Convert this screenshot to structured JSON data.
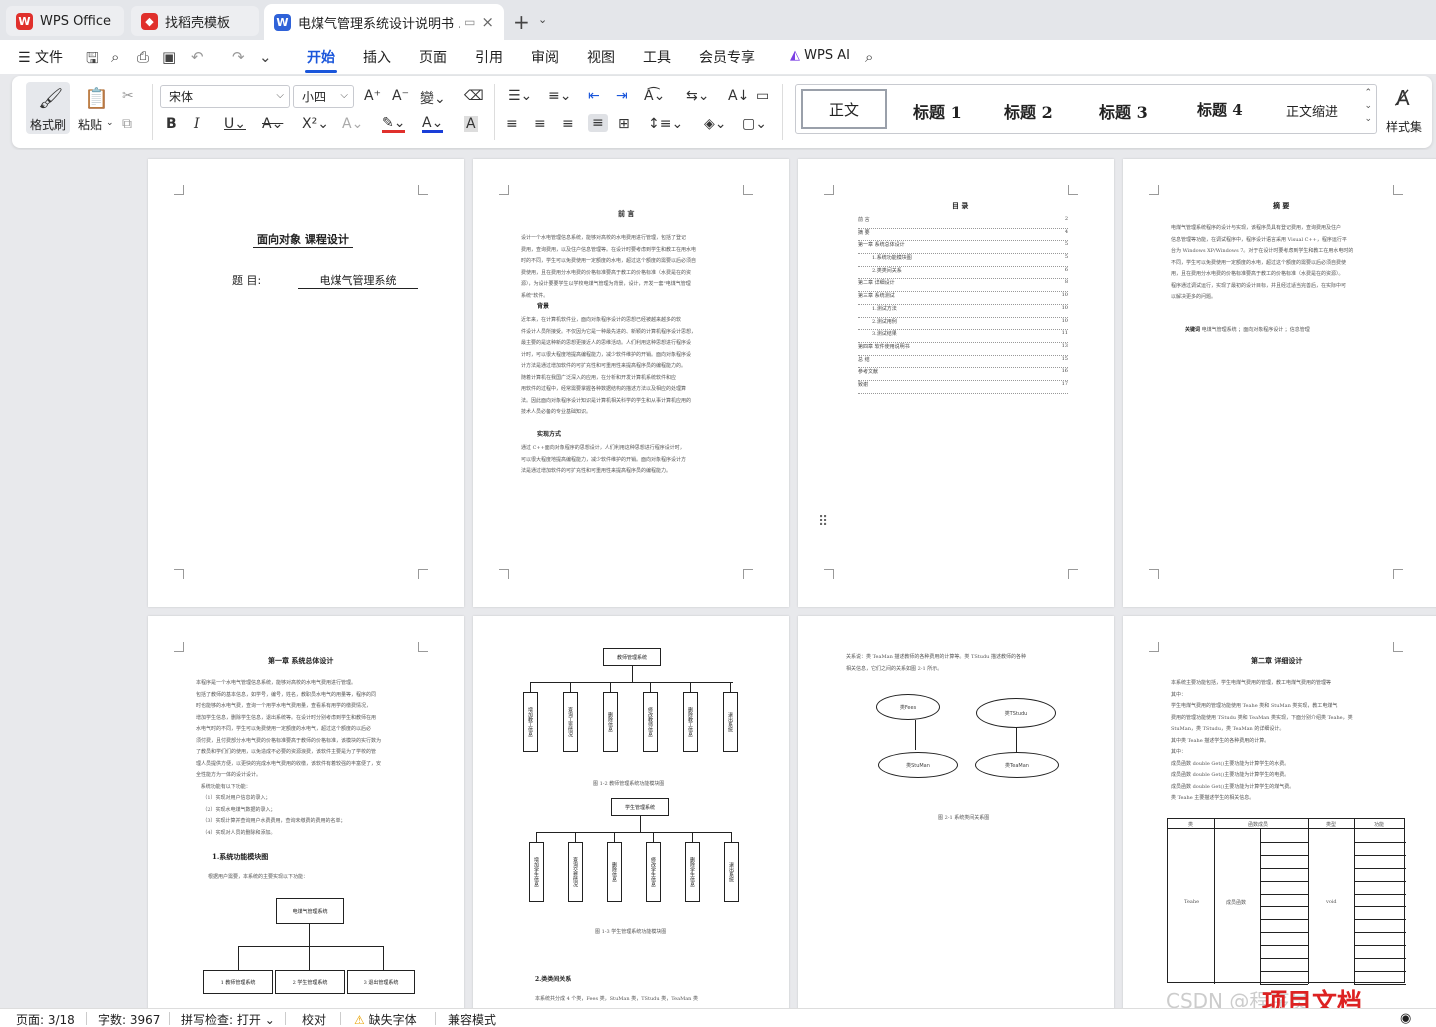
{
  "tabs": [
    {
      "label": "WPS Office",
      "color": "#e0302c"
    },
    {
      "label": "找稻壳模板",
      "color": "#e0302c"
    },
    {
      "label": "电煤气管理系统设计说明书 .d",
      "color": "#2f62d8"
    }
  ],
  "menu": {
    "file": "文件",
    "items": [
      "开始",
      "插入",
      "页面",
      "引用",
      "审阅",
      "视图",
      "工具",
      "会员专享"
    ],
    "ai": "WPS AI"
  },
  "ribbon": {
    "format_painter": "格式刷",
    "paste": "粘贴",
    "font_name": "宋体",
    "font_size": "小四",
    "styles": [
      "正文",
      "标题 1",
      "标题 2",
      "标题 3",
      "标题 4",
      "正文缩进"
    ],
    "style_set": "样式集"
  },
  "pages": {
    "p1": {
      "title": "面向对象  课程设计",
      "subject_label": "题    目:",
      "subject": "电煤气管理系统"
    },
    "p2": {
      "title": "前  言",
      "h1": "背景",
      "h2": "实现方式"
    },
    "p3": {
      "title": "目  录",
      "toc": [
        "前  言",
        "摘  要",
        "第一章  系统总体设计",
        "1.系统功能模块图",
        "2.类类间关系",
        "第二章  详细设计",
        "第三章  系统测试",
        "1.测试方法",
        "2.测试用例",
        "3.测试结果",
        "第四章  软件使用说明书",
        "总  结",
        "参考文献",
        "致谢"
      ],
      "toc_pages": [
        "2",
        "4",
        "5",
        "5",
        "6",
        "8",
        "10",
        "10",
        "10",
        "11",
        "13",
        "15",
        "16",
        "17"
      ]
    },
    "p4": {
      "title": "摘  要",
      "keywords": "关键词"
    },
    "p5": {
      "title": "第一章  系统总体设计",
      "h1": "1.系统功能模块图",
      "chart_root": "电煤气管理系统",
      "chart_children": [
        "1 教师管理系统",
        "2 学生管理系统",
        "3 退出管理系统"
      ]
    },
    "p6": {
      "root1": "教师管理系统",
      "children1": [
        "增加教工信息",
        "查询工资情况",
        "删除信息",
        "修改教师信息",
        "删除教工信息",
        "退出系统"
      ],
      "cap1": "图 1-2 教师管理系统功能模块图",
      "root2": "学生管理系统",
      "children2": [
        "增加学生信息",
        "查询交费情况",
        "删除信息",
        "修改学生信息",
        "删除学生信息",
        "退出系统"
      ],
      "cap2": "图 1-3 学生管理系统功能模块图",
      "h2": "2.类类间关系"
    },
    "p7": {
      "cap": "图 2-1 系统类间关系图",
      "nodes": [
        "类Fees",
        "类TStudu",
        "类StuMan",
        "类TeaMan"
      ]
    },
    "p8": {
      "title": "第二章  详细设计",
      "tbl_headers": [
        "类",
        "函数成员",
        "",
        "类型",
        "功能"
      ],
      "tbl_class": "Teahe",
      "tbl_member": "成员函数",
      "tbl_type": "void"
    }
  },
  "status": {
    "page": "页面: 3/18",
    "words": "字数: 3967",
    "spell": "拼写检查: 打开",
    "proof": "校对",
    "font_missing": "缺失字体",
    "compat": "兼容模式"
  },
  "watermark": "CSDN @程序员",
  "watermark2": "项目文档"
}
